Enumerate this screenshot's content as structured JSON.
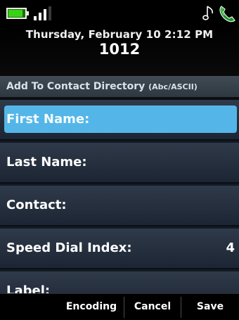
{
  "status": {
    "battery_level": 0.85,
    "signal_bars": 3,
    "icons": [
      "battery-icon",
      "signal-icon",
      "ringer-note-icon",
      "handset-status-icon"
    ]
  },
  "header": {
    "date_time": "Thursday, February 10 2:12 PM",
    "extension": "1012",
    "title": "Add To Contact Directory",
    "encoding_tag": "(Abc/ASCII)"
  },
  "fields": [
    {
      "label": "First Name:",
      "value": "",
      "selected": true
    },
    {
      "label": "Last Name:",
      "value": ""
    },
    {
      "label": "Contact:",
      "value": ""
    },
    {
      "label": "Speed Dial Index:",
      "value": "4"
    },
    {
      "label": "Label:",
      "value": ""
    }
  ],
  "softkeys": {
    "encoding": "Encoding",
    "cancel": "Cancel",
    "save": "Save"
  },
  "colors": {
    "highlight": "#54b6e8",
    "row": "#2f3a4a",
    "battery": "#3bd117"
  }
}
